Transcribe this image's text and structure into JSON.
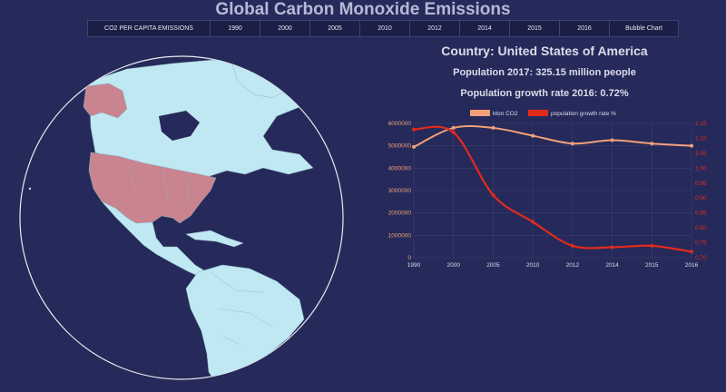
{
  "page": {
    "title": "Global Carbon Monoxide Emissions"
  },
  "nav": {
    "items": [
      {
        "label": "CO2 PER CAPITA EMISSIONS"
      },
      {
        "label": "1990"
      },
      {
        "label": "2000"
      },
      {
        "label": "2005"
      },
      {
        "label": "2010"
      },
      {
        "label": "2012"
      },
      {
        "label": "2014"
      },
      {
        "label": "2015"
      },
      {
        "label": "2016"
      },
      {
        "label": "Bubble Chart"
      }
    ]
  },
  "info": {
    "country": "Country: United States of America",
    "population": "Population 2017: 325.15 million people",
    "growth": "Population growth rate 2016: 0.72%"
  },
  "colors": {
    "background": "#262a5a",
    "land": "#bfe8f2",
    "highlight": "#c9848f",
    "co2_line": "#f2a07a",
    "growth_line": "#e22a1c"
  },
  "chart_data": {
    "type": "line",
    "x": [
      "1990",
      "2000",
      "2005",
      "2010",
      "2012",
      "2014",
      "2015",
      "2016"
    ],
    "series": [
      {
        "name": "kton CO2",
        "axis": "left",
        "values": [
          4950000,
          5800000,
          5800000,
          5450000,
          5100000,
          5250000,
          5100000,
          5000000
        ]
      },
      {
        "name": "population growth rate %",
        "axis": "right",
        "values": [
          1.13,
          1.12,
          0.91,
          0.82,
          0.74,
          0.735,
          0.74,
          0.72
        ]
      }
    ],
    "y_left": {
      "ticks": [
        "0",
        "1000000",
        "2000000",
        "3000000",
        "4000000",
        "5000000",
        "6000000"
      ],
      "ylim": [
        0,
        6000000
      ]
    },
    "y_right": {
      "ticks": [
        "0.70",
        "0.75",
        "0.80",
        "0.85",
        "0.90",
        "0.95",
        "1.00",
        "1.05",
        "1.10",
        "1.15"
      ],
      "ylim": [
        0.7,
        1.15
      ]
    },
    "legend_position": "top-center",
    "grid": true
  }
}
